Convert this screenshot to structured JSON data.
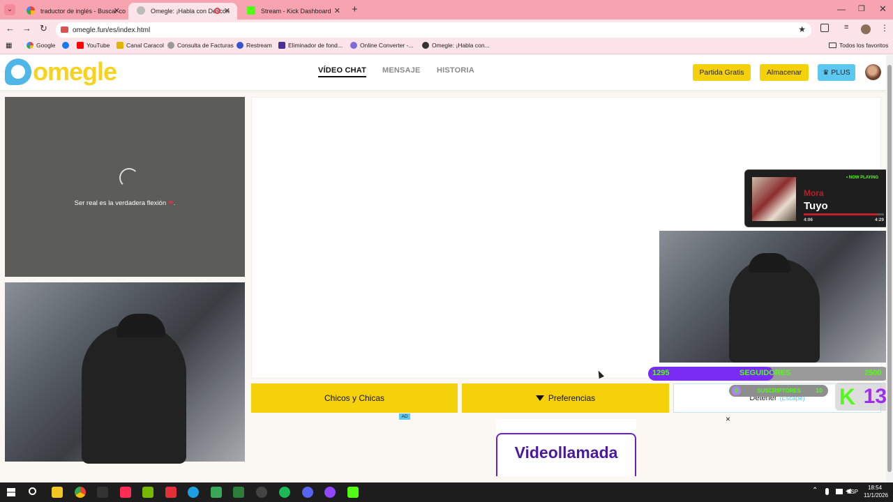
{
  "tabs": [
    {
      "label": "traductor de inglés - Buscar co",
      "active": false
    },
    {
      "label": "Omegle: ¡Habla con Descon",
      "active": true
    },
    {
      "label": "Stream - Kick Dashboard",
      "active": false
    }
  ],
  "address": {
    "url": "omegle.fun/es/index.html"
  },
  "bookmarks": [
    "Google",
    "YouTube",
    "Canal Caracol",
    "Consulta de Facturas",
    "Restream",
    "Eliminador de fond...",
    "Online Converter -...",
    "Omegle: ¡Habla con..."
  ],
  "bookmarks_all": "Todos los favoritos",
  "site": {
    "logo": "omegle",
    "nav": [
      "VÍDEO CHAT",
      "MENSAJE",
      "HISTORIA"
    ],
    "buttons": {
      "free": "Partida Gratis",
      "store": "Almacenar",
      "plus": "PLUS"
    },
    "loading_text": "Ser real es la verdadera flexión",
    "gender_button": "Chicos y Chicas",
    "prefs_button": "Preferencias",
    "stop_button": "Detener",
    "stop_hint": "(Escape)",
    "ad_badge": "AD",
    "ad_title": "Videollamada",
    "close": "×"
  },
  "overlay": {
    "now_playing": "• NOW PLAYING",
    "artist": "Mora",
    "song": "Tuyo",
    "time_elapsed": "4:06",
    "time_total": "4:29",
    "progress": 0.91,
    "followers_current": "1295",
    "followers_label": "SEGUIDORES",
    "followers_goal": "2500",
    "followers_progress": 0.52,
    "subs_current": "0",
    "subs_label": "SUSCRIPTORES",
    "subs_goal": "10",
    "kick_count": "13"
  },
  "taskbar": {
    "lang": "ESP",
    "time": "18:54",
    "date": "11/1/2026"
  },
  "colors": {
    "accent_yellow": "#f5d10c",
    "brand_blue": "#4fb6e8",
    "logo_yellow": "#f7d21e",
    "tab_pink": "#f7a3b0",
    "kick_green": "#53fc18",
    "purple": "#7a2cf5"
  }
}
